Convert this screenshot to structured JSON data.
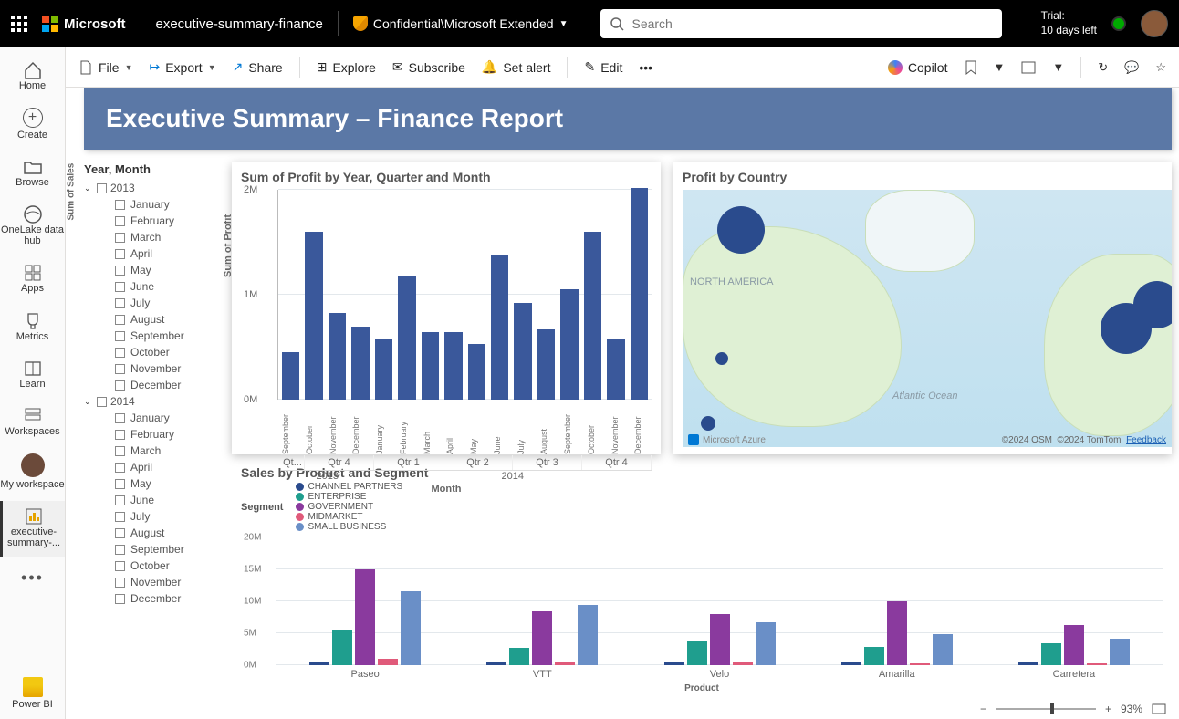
{
  "topbar": {
    "brand": "Microsoft",
    "workspace_name": "executive-summary-finance",
    "sensitivity": "Confidential\\Microsoft Extended",
    "search_placeholder": "Search",
    "trial_line1": "Trial:",
    "trial_line2": "10 days left"
  },
  "rail": {
    "home": "Home",
    "create": "Create",
    "browse": "Browse",
    "onelake": "OneLake data hub",
    "apps": "Apps",
    "metrics": "Metrics",
    "learn": "Learn",
    "workspaces": "Workspaces",
    "myws": "My workspace",
    "current": "executive-summary-...",
    "powerbi": "Power BI"
  },
  "cmd": {
    "file": "File",
    "export": "Export",
    "share": "Share",
    "explore": "Explore",
    "subscribe": "Subscribe",
    "setalert": "Set alert",
    "edit": "Edit",
    "copilot": "Copilot"
  },
  "banner": "Executive Summary – Finance Report",
  "slicer": {
    "title": "Year, Month",
    "years": [
      {
        "year": "2013",
        "months": [
          "January",
          "February",
          "March",
          "April",
          "May",
          "June",
          "July",
          "August",
          "September",
          "October",
          "November",
          "December"
        ]
      },
      {
        "year": "2014",
        "months": [
          "January",
          "February",
          "March",
          "April",
          "May",
          "June",
          "July",
          "August",
          "September",
          "October",
          "November",
          "December"
        ]
      }
    ]
  },
  "profit": {
    "title": "Sum of Profit by Year, Quarter and Month",
    "y_title": "Sum of Profit",
    "x_title": "Month",
    "y_ticks": [
      "0M",
      "1M",
      "2M"
    ],
    "quarters": [
      {
        "label": "Qt...",
        "w": 1
      },
      {
        "label": "Qtr 4",
        "w": 3
      },
      {
        "label": "Qtr 1",
        "w": 3
      },
      {
        "label": "Qtr 2",
        "w": 3
      },
      {
        "label": "Qtr 3",
        "w": 3
      },
      {
        "label": "Qtr 4",
        "w": 3
      }
    ],
    "year_spans": [
      {
        "label": "2013",
        "w": 4
      },
      {
        "label": "2014",
        "w": 12
      }
    ]
  },
  "map": {
    "title": "Profit by Country",
    "labels": {
      "na": "NORTH AMERICA",
      "ao": "Atlantic Ocean"
    },
    "azure": "Microsoft Azure",
    "attr_osm": "©2024 OSM",
    "attr_tomtom": "©2024 TomTom",
    "feedback": "Feedback"
  },
  "sales": {
    "title": "Sales by Product and Segment",
    "legend_title": "Segment",
    "segments": [
      {
        "name": "CHANNEL PARTNERS",
        "color": "#2a4b8d"
      },
      {
        "name": "ENTERPRISE",
        "color": "#1f9e8e"
      },
      {
        "name": "GOVERNMENT",
        "color": "#8a3a9e"
      },
      {
        "name": "MIDMARKET",
        "color": "#e05a7a"
      },
      {
        "name": "SMALL BUSINESS",
        "color": "#6a8fc7"
      }
    ],
    "y_title": "Sum of Sales",
    "x_title": "Product",
    "y_ticks": [
      "0M",
      "5M",
      "10M",
      "15M",
      "20M"
    ]
  },
  "footer": {
    "zoom": "93%"
  },
  "chart_data": [
    {
      "type": "bar",
      "title": "Sum of Profit by Year, Quarter and Month",
      "ylabel": "Sum of Profit",
      "xlabel": "Month",
      "ylim": [
        0,
        2000000
      ],
      "categories": [
        "September",
        "October",
        "November",
        "December",
        "January",
        "February",
        "March",
        "April",
        "May",
        "June",
        "July",
        "August",
        "September",
        "October",
        "November",
        "December"
      ],
      "values": [
        450000,
        1600000,
        830000,
        700000,
        580000,
        1170000,
        640000,
        640000,
        530000,
        1380000,
        920000,
        670000,
        1050000,
        1600000,
        580000,
        2020000
      ],
      "hierarchy": {
        "2013": {
          "Qtr 3": [
            "September"
          ],
          "Qtr 4": [
            "October",
            "November",
            "December"
          ]
        },
        "2014": {
          "Qtr 1": [
            "January",
            "February",
            "March"
          ],
          "Qtr 2": [
            "April",
            "May",
            "June"
          ],
          "Qtr 3": [
            "July",
            "August",
            "September"
          ],
          "Qtr 4": [
            "October",
            "November",
            "December"
          ]
        }
      }
    },
    {
      "type": "bar",
      "title": "Sales by Product and Segment",
      "ylabel": "Sum of Sales",
      "xlabel": "Product",
      "ylim": [
        0,
        20000000
      ],
      "categories": [
        "Paseo",
        "VTT",
        "Velo",
        "Amarilla",
        "Carretera"
      ],
      "series": [
        {
          "name": "CHANNEL PARTNERS",
          "values": [
            600000,
            500000,
            400000,
            400000,
            400000
          ]
        },
        {
          "name": "ENTERPRISE",
          "values": [
            5600000,
            2700000,
            3900000,
            2900000,
            3400000
          ]
        },
        {
          "name": "GOVERNMENT",
          "values": [
            15000000,
            8400000,
            8000000,
            10000000,
            6300000
          ]
        },
        {
          "name": "MIDMARKET",
          "values": [
            1000000,
            400000,
            400000,
            300000,
            300000
          ]
        },
        {
          "name": "SMALL BUSINESS",
          "values": [
            11600000,
            9500000,
            6700000,
            4900000,
            4200000
          ]
        }
      ]
    },
    {
      "type": "map",
      "title": "Profit by Country",
      "points": [
        {
          "region": "Canada",
          "approx_lat": 54,
          "approx_lon": -105,
          "size": "large"
        },
        {
          "region": "USA",
          "approx_lat": 38,
          "approx_lon": -97,
          "size": "small"
        },
        {
          "region": "Mexico",
          "approx_lat": 20,
          "approx_lon": -100,
          "size": "small"
        },
        {
          "region": "France",
          "approx_lat": 47,
          "approx_lon": 2,
          "size": "large"
        },
        {
          "region": "Germany",
          "approx_lat": 51,
          "approx_lon": 10,
          "size": "large"
        }
      ]
    }
  ]
}
